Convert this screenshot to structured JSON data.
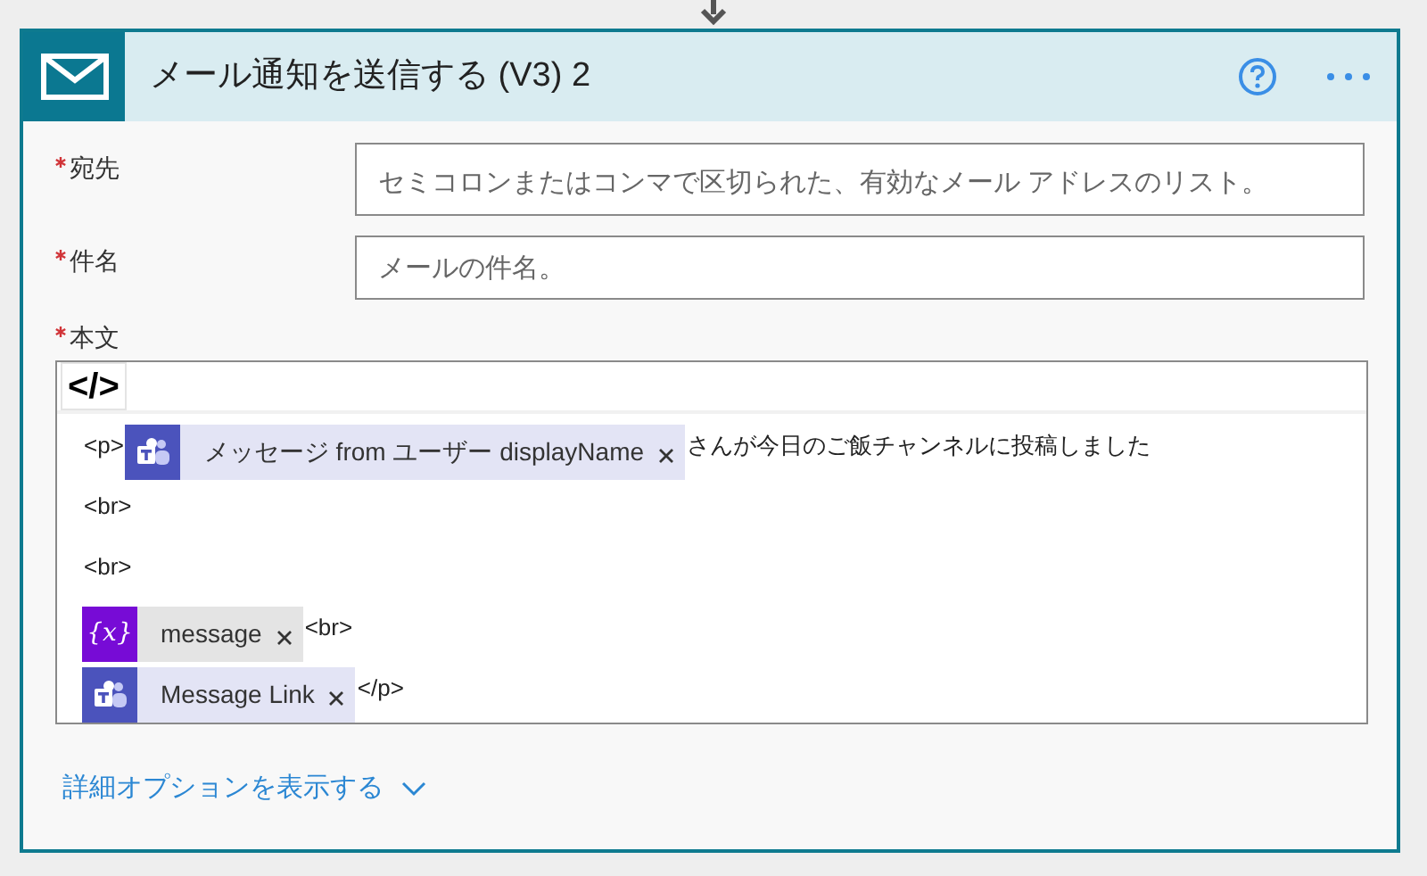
{
  "card": {
    "title": "メール通知を送信する (V3) 2"
  },
  "fields": [
    {
      "label": "宛先",
      "required": true,
      "placeholder": "セミコロンまたはコンマで区切られた、有効なメール アドレスのリスト。"
    },
    {
      "label": "件名",
      "required": true,
      "placeholder": "メールの件名。"
    }
  ],
  "body": {
    "label": "本文",
    "required": true,
    "code_button": "</>",
    "lines": [
      [
        {
          "kind": "text",
          "text": "<p>"
        },
        {
          "kind": "teams",
          "label": "メッセージ from ユーザー displayName"
        },
        {
          "kind": "text",
          "text": "さんが今日のご飯チャンネルに投稿しました"
        }
      ],
      [
        {
          "kind": "text",
          "text": "<br>"
        }
      ],
      [
        {
          "kind": "text",
          "text": "<br>"
        }
      ],
      [
        {
          "kind": "variable",
          "icon_text": "{x}",
          "label": "message"
        },
        {
          "kind": "text",
          "text": "<br>"
        }
      ],
      [
        {
          "kind": "teams",
          "label": "Message Link"
        },
        {
          "kind": "text",
          "text": "</p>"
        }
      ]
    ]
  },
  "advanced_link": "詳細オプションを表示する"
}
